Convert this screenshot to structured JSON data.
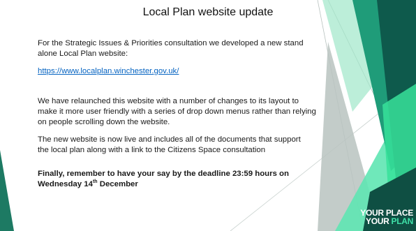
{
  "slide": {
    "title": "Local Plan website update",
    "para1": "For the Strategic Issues & Priorities consultation we developed a new stand alone Local Plan website:",
    "link": "https://www.localplan.winchester.gov.uk/",
    "para2": "We have relaunched this website with a number of changes to its layout to make it more user friendly with a series of drop down menus rather than relying on people scrolling down the website.",
    "para3": "The new website is now live and includes all of the documents that support the local plan along with a link to the Citizens Space consultation",
    "para4_prefix": "Finally, remember to have your say by the deadline 23:59 hours on Wednesday 14",
    "para4_sup": "th",
    "para4_suffix": " December"
  },
  "brand": {
    "your1": "YOUR",
    "place": " PLACE",
    "your2": "YOUR",
    "plan": " PLAN"
  },
  "colors": {
    "dark_teal": "#0e5a4c",
    "mid_teal": "#1d9a78",
    "bright_green": "#37e29a",
    "light_grey": "#c7cfcc"
  }
}
